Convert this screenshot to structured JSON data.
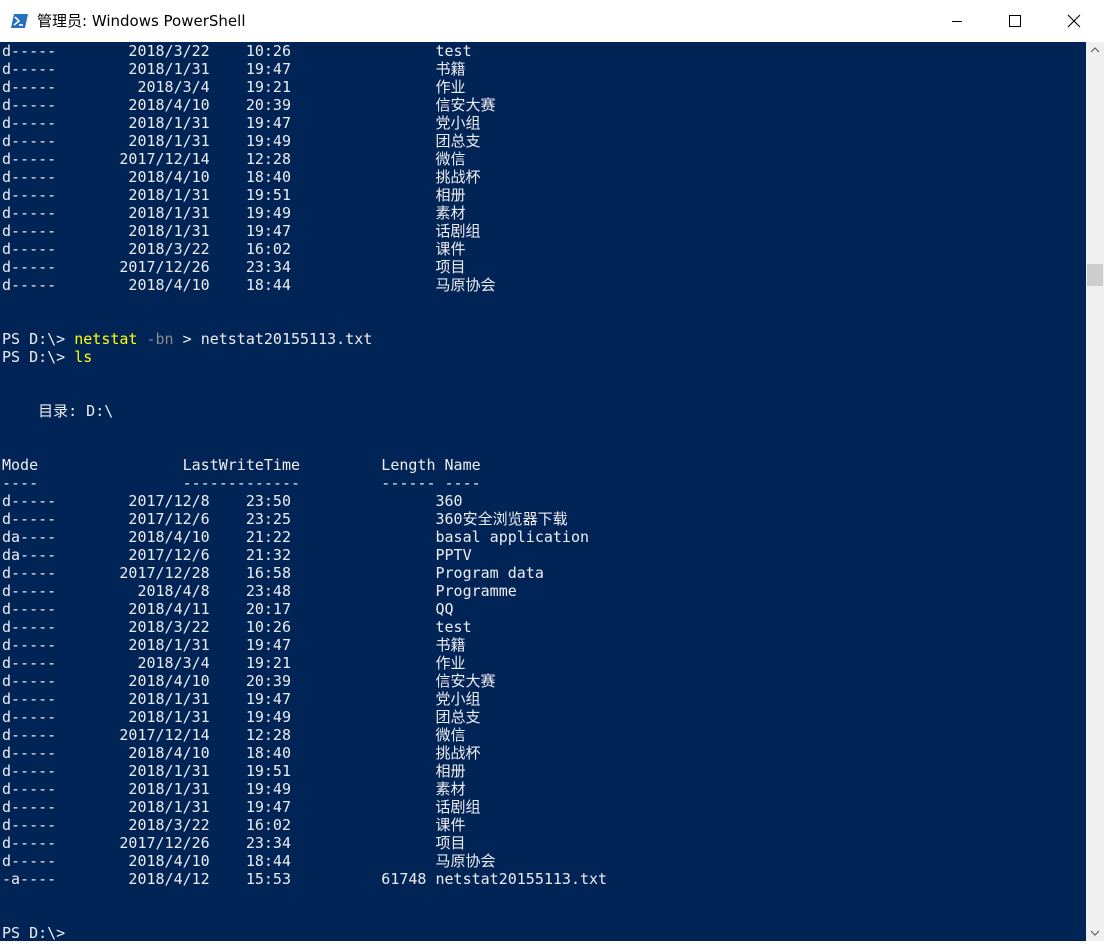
{
  "window": {
    "title": "管理员: Windows PowerShell",
    "colors": {
      "background": "#012456",
      "text": "#eeedf0",
      "command": "#ffff00",
      "parameter": "#8a8a8a"
    }
  },
  "icons": {
    "app": "powershell-icon",
    "minimize": "minimize-icon",
    "maximize": "maximize-icon",
    "close": "close-icon"
  },
  "console": {
    "top_rows": [
      {
        "mode": "d-----",
        "date": "2018/3/22",
        "time": "10:26",
        "name": "test"
      },
      {
        "mode": "d-----",
        "date": "2018/1/31",
        "time": "19:47",
        "name": "书籍"
      },
      {
        "mode": "d-----",
        "date": "2018/3/4",
        "time": "19:21",
        "name": "作业"
      },
      {
        "mode": "d-----",
        "date": "2018/4/10",
        "time": "20:39",
        "name": "信安大赛"
      },
      {
        "mode": "d-----",
        "date": "2018/1/31",
        "time": "19:47",
        "name": "党小组"
      },
      {
        "mode": "d-----",
        "date": "2018/1/31",
        "time": "19:49",
        "name": "团总支"
      },
      {
        "mode": "d-----",
        "date": "2017/12/14",
        "time": "12:28",
        "name": "微信"
      },
      {
        "mode": "d-----",
        "date": "2018/4/10",
        "time": "18:40",
        "name": "挑战杯"
      },
      {
        "mode": "d-----",
        "date": "2018/1/31",
        "time": "19:51",
        "name": "相册"
      },
      {
        "mode": "d-----",
        "date": "2018/1/31",
        "time": "19:49",
        "name": "素材"
      },
      {
        "mode": "d-----",
        "date": "2018/1/31",
        "time": "19:47",
        "name": "话剧组"
      },
      {
        "mode": "d-----",
        "date": "2018/3/22",
        "time": "16:02",
        "name": "课件"
      },
      {
        "mode": "d-----",
        "date": "2017/12/26",
        "time": "23:34",
        "name": "项目"
      },
      {
        "mode": "d-----",
        "date": "2018/4/10",
        "time": "18:44",
        "name": "马原协会"
      }
    ],
    "prompt": "PS D:\\>",
    "command1": {
      "cmd": "netstat",
      "param": "-bn",
      "redirect": ">",
      "arg": "netstat20155113.txt"
    },
    "command2": {
      "cmd": "ls"
    },
    "directory_label": "目录: D:\\",
    "headers": {
      "mode": "Mode",
      "lastwritetime": "LastWriteTime",
      "length": "Length",
      "name": "Name"
    },
    "underlines": {
      "mode": "----",
      "lastwritetime": "-------------",
      "length": "------",
      "name": "----"
    },
    "listing": [
      {
        "mode": "d-----",
        "date": "2017/12/8",
        "time": "23:50",
        "length": "",
        "name": "360"
      },
      {
        "mode": "d-----",
        "date": "2017/12/6",
        "time": "23:25",
        "length": "",
        "name": "360安全浏览器下载"
      },
      {
        "mode": "da----",
        "date": "2018/4/10",
        "time": "21:22",
        "length": "",
        "name": "basal application"
      },
      {
        "mode": "da----",
        "date": "2017/12/6",
        "time": "21:32",
        "length": "",
        "name": "PPTV"
      },
      {
        "mode": "d-----",
        "date": "2017/12/28",
        "time": "16:58",
        "length": "",
        "name": "Program data"
      },
      {
        "mode": "d-----",
        "date": "2018/4/8",
        "time": "23:48",
        "length": "",
        "name": "Programme"
      },
      {
        "mode": "d-----",
        "date": "2018/4/11",
        "time": "20:17",
        "length": "",
        "name": "QQ"
      },
      {
        "mode": "d-----",
        "date": "2018/3/22",
        "time": "10:26",
        "length": "",
        "name": "test"
      },
      {
        "mode": "d-----",
        "date": "2018/1/31",
        "time": "19:47",
        "length": "",
        "name": "书籍"
      },
      {
        "mode": "d-----",
        "date": "2018/3/4",
        "time": "19:21",
        "length": "",
        "name": "作业"
      },
      {
        "mode": "d-----",
        "date": "2018/4/10",
        "time": "20:39",
        "length": "",
        "name": "信安大赛"
      },
      {
        "mode": "d-----",
        "date": "2018/1/31",
        "time": "19:47",
        "length": "",
        "name": "党小组"
      },
      {
        "mode": "d-----",
        "date": "2018/1/31",
        "time": "19:49",
        "length": "",
        "name": "团总支"
      },
      {
        "mode": "d-----",
        "date": "2017/12/14",
        "time": "12:28",
        "length": "",
        "name": "微信"
      },
      {
        "mode": "d-----",
        "date": "2018/4/10",
        "time": "18:40",
        "length": "",
        "name": "挑战杯"
      },
      {
        "mode": "d-----",
        "date": "2018/1/31",
        "time": "19:51",
        "length": "",
        "name": "相册"
      },
      {
        "mode": "d-----",
        "date": "2018/1/31",
        "time": "19:49",
        "length": "",
        "name": "素材"
      },
      {
        "mode": "d-----",
        "date": "2018/1/31",
        "time": "19:47",
        "length": "",
        "name": "话剧组"
      },
      {
        "mode": "d-----",
        "date": "2018/3/22",
        "time": "16:02",
        "length": "",
        "name": "课件"
      },
      {
        "mode": "d-----",
        "date": "2017/12/26",
        "time": "23:34",
        "length": "",
        "name": "项目"
      },
      {
        "mode": "d-----",
        "date": "2018/4/10",
        "time": "18:44",
        "length": "",
        "name": "马原协会"
      },
      {
        "mode": "-a----",
        "date": "2018/4/12",
        "time": "15:53",
        "length": "61748",
        "name": "netstat20155113.txt"
      }
    ]
  }
}
